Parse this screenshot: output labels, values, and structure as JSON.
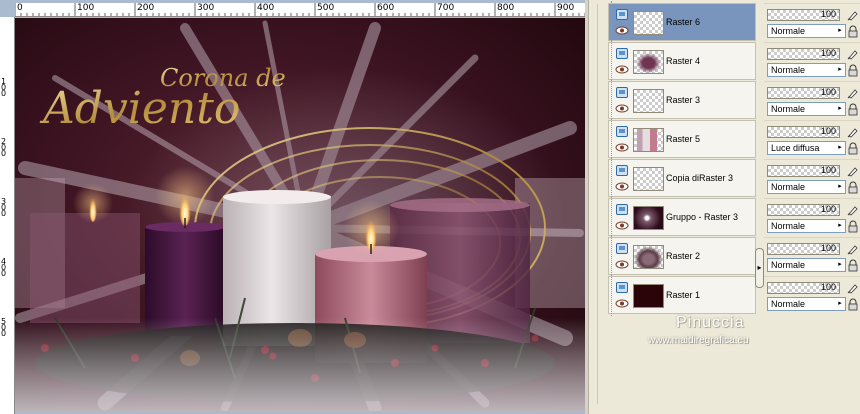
{
  "ruler": {
    "top_labels": [
      "0",
      "100",
      "200",
      "300",
      "400",
      "500",
      "600",
      "700",
      "800",
      "900"
    ],
    "left_labels": [
      "1 0 0",
      "2 0 0",
      "3 0 0",
      "4 0 0",
      "5 0 0"
    ]
  },
  "artwork": {
    "title_line1": "Corona de",
    "title_line2": "Adviento",
    "colors": {
      "background": "#2a0a12",
      "gold": "#c9a85a",
      "candle_white": "#d9d2d4",
      "candle_pink": "#b87384",
      "candle_purple": "#4a1a44"
    }
  },
  "layers": [
    {
      "name": "Raster 6",
      "selected": true,
      "thumb": "transparent",
      "opacity": "100",
      "blend": "Normale"
    },
    {
      "name": "Raster 4",
      "selected": false,
      "thumb": "pink-blob",
      "opacity": "100",
      "blend": "Normale"
    },
    {
      "name": "Raster 3",
      "selected": false,
      "thumb": "transparent",
      "opacity": "100",
      "blend": "Normale"
    },
    {
      "name": "Raster 5",
      "selected": false,
      "thumb": "candles",
      "opacity": "100",
      "blend": "Luce diffusa"
    },
    {
      "name": "Copia diRaster 3",
      "selected": false,
      "thumb": "transparent",
      "opacity": "100",
      "blend": "Normale"
    },
    {
      "name": "Gruppo - Raster 3",
      "selected": false,
      "thumb": "rays",
      "opacity": "100",
      "blend": "Normale"
    },
    {
      "name": "Raster 2",
      "selected": false,
      "thumb": "wreath",
      "opacity": "100",
      "blend": "Normale"
    },
    {
      "name": "Raster 1",
      "selected": false,
      "thumb": "dark-fill",
      "opacity": "100",
      "blend": "Normale"
    }
  ],
  "watermark": {
    "name": "Pinuccia",
    "url": "www.maidiregrafica.eu"
  },
  "icons": {
    "visibility": "layer-visibility-icon",
    "eye": "eye-icon",
    "brush": "brush-icon",
    "lock": "lock-icon",
    "collapse": "chevron-right-icon"
  }
}
